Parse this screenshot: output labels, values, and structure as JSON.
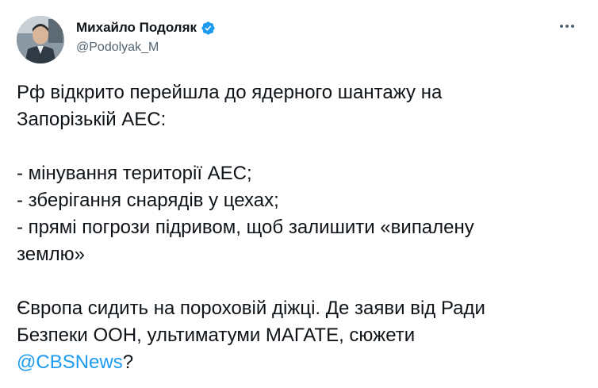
{
  "author": {
    "name": "Михайло Подоляк",
    "handle": "@Podolyak_M",
    "verified": true,
    "verified_color": "#1d9bf0"
  },
  "menu": {
    "icon": "more-horizontal-icon"
  },
  "tweet": {
    "p1_l1": "Рф відкрито перейшла до ядерного шантажу на",
    "p1_l2": "Запорізькій АЕС:",
    "bullet1": "- мінування території АЕС;",
    "bullet2": "- зберігання снарядів у цехах;",
    "bullet3_l1": "- прямі погрози підривом, щоб залишити «випалену",
    "bullet3_l2": "землю»",
    "p3_l1": "Європа сидить на пороховій діжці. Де заяви від Ради",
    "p3_l2": "Безпеки ООН, ультиматуми МАГАТЕ, сюжети",
    "mention": "@CBSNews",
    "question_mark": "?"
  },
  "colors": {
    "link": "#1d9bf0",
    "text": "#0f1419",
    "secondary": "#536471"
  }
}
